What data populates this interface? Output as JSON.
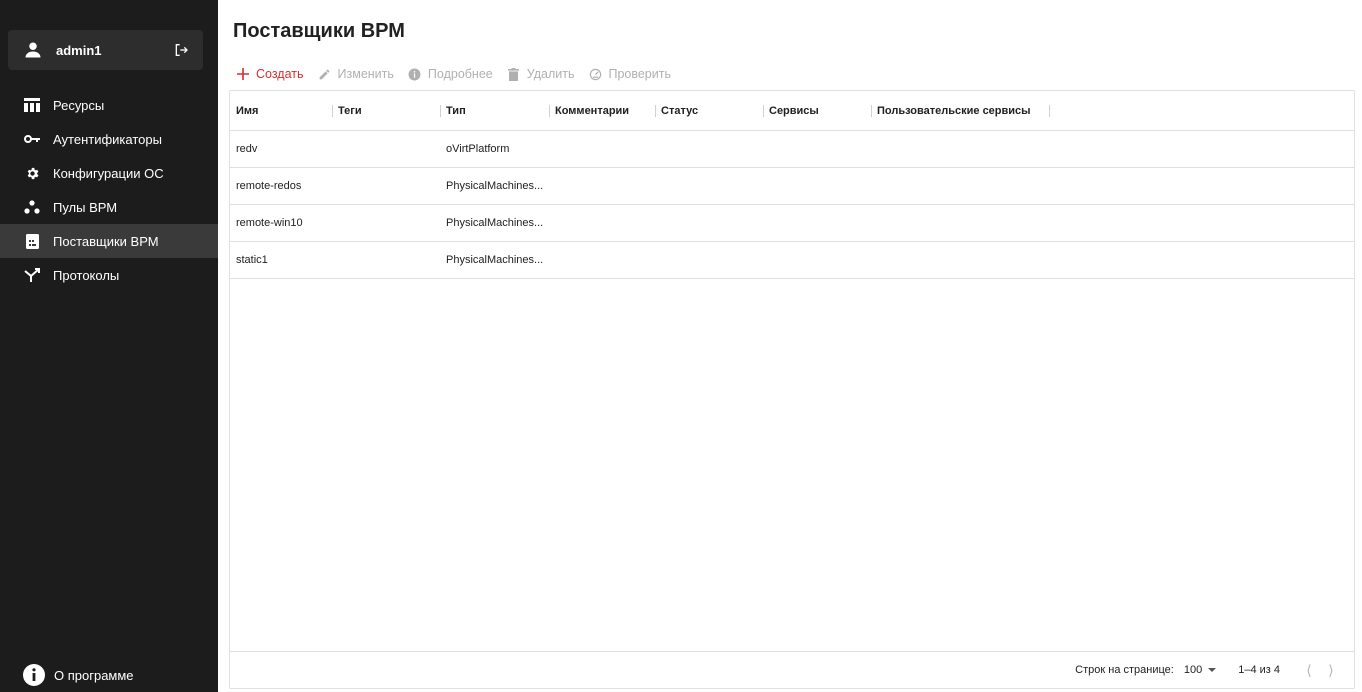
{
  "user": {
    "name": "admin1"
  },
  "nav": {
    "items": [
      {
        "label": "Ресурсы",
        "icon": "table-icon"
      },
      {
        "label": "Аутентификаторы",
        "icon": "key-icon"
      },
      {
        "label": "Конфигурации ОС",
        "icon": "gear-icon"
      },
      {
        "label": "Пулы ВРМ",
        "icon": "pools-icon"
      },
      {
        "label": "Поставщики ВРМ",
        "icon": "provider-icon",
        "active": true
      },
      {
        "label": "Протоколы",
        "icon": "protocol-icon"
      }
    ],
    "about": "О программе"
  },
  "page": {
    "title": "Поставщики ВРМ"
  },
  "toolbar": {
    "create": "Создать",
    "edit": "Изменить",
    "details": "Подробнее",
    "delete": "Удалить",
    "check": "Проверить"
  },
  "table": {
    "columns": [
      "Имя",
      "Теги",
      "Тип",
      "Комментарии",
      "Статус",
      "Сервисы",
      "Пользовательские сервисы"
    ],
    "rows": [
      {
        "name": "redv",
        "tags": "",
        "type": "oVirtPlatform",
        "comments": "",
        "status": "",
        "services": "",
        "user_services": ""
      },
      {
        "name": "remote-redos",
        "tags": "",
        "type": "PhysicalMachines...",
        "comments": "",
        "status": "",
        "services": "",
        "user_services": ""
      },
      {
        "name": "remote-win10",
        "tags": "",
        "type": "PhysicalMachines...",
        "comments": "",
        "status": "",
        "services": "",
        "user_services": ""
      },
      {
        "name": "static1",
        "tags": "",
        "type": "PhysicalMachines...",
        "comments": "",
        "status": "",
        "services": "",
        "user_services": ""
      }
    ]
  },
  "pagination": {
    "rows_per_page_label": "Строк на странице:",
    "rows_per_page": "100",
    "range": "1–4 из 4"
  },
  "colors": {
    "sidebar_bg": "#1c1c1c",
    "accent": "#d32f2f",
    "disabled": "#b0b0b0"
  }
}
